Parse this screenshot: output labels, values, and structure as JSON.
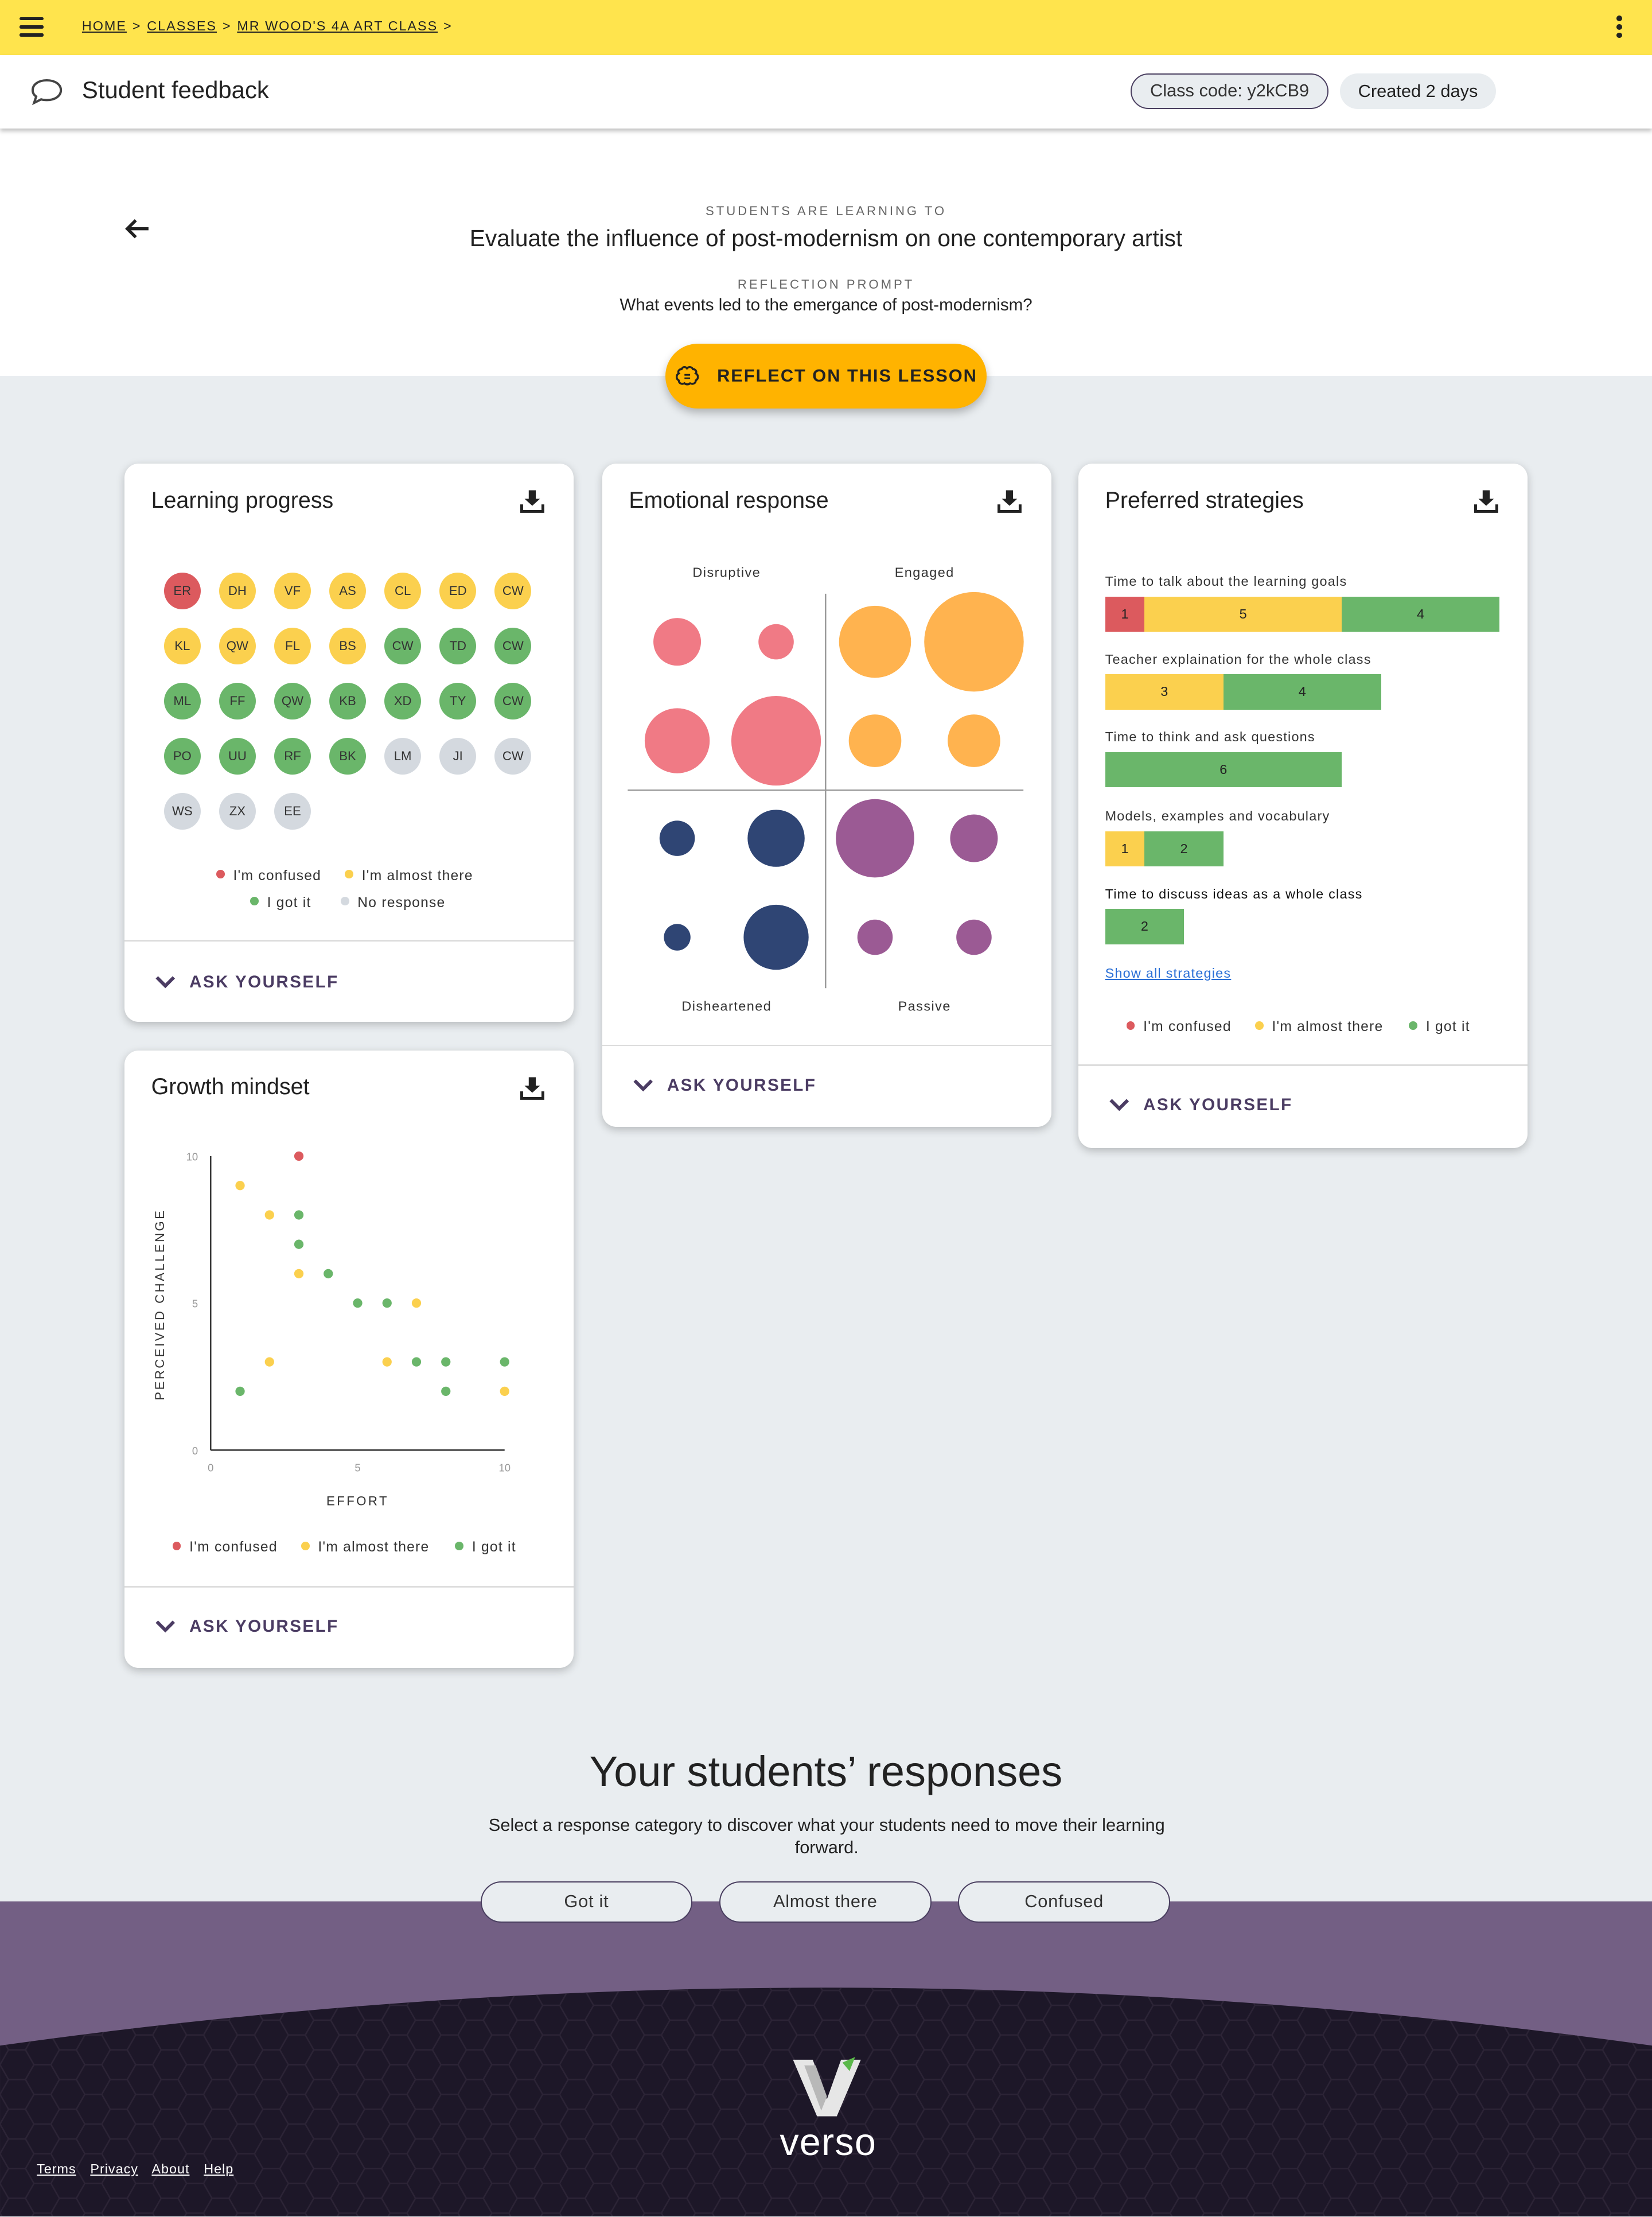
{
  "topbar": {
    "breadcrumbs": [
      {
        "label": "HOME"
      },
      {
        "label": "CLASSES"
      },
      {
        "label": "MR WOOD'S 4A ART CLASS"
      }
    ],
    "menu_icon": "hamburger-menu-icon",
    "more_icon": "vertical-dots-icon"
  },
  "header": {
    "title": "Student feedback",
    "icon": "chat-bubble-icon",
    "class_code": "Class code: y2kCB9",
    "created": "Created 2 days"
  },
  "lesson": {
    "learning_label": "STUDENTS ARE LEARNING TO",
    "learning_objective": "Evaluate the influence of post-modernism on one contemporary artist",
    "prompt_label": "REFLECTION PROMPT",
    "prompt": "What events led to the emergance of post-modernism?",
    "reflect_button": "REFLECT ON THIS LESSON",
    "reflect_icon": "brain-icon"
  },
  "colors": {
    "confused": "#dc5a5e",
    "almost": "#fbd04e",
    "gotit": "#6ab66a",
    "none": "#d4d9df",
    "accent_yellow": "#ffe44d",
    "reflect_orange": "#ffb300",
    "purple": "#735f84"
  },
  "learning_progress": {
    "title": "Learning progress",
    "students": [
      {
        "initials": "ER",
        "status": "confused"
      },
      {
        "initials": "DH",
        "status": "almost"
      },
      {
        "initials": "VF",
        "status": "almost"
      },
      {
        "initials": "AS",
        "status": "almost"
      },
      {
        "initials": "CL",
        "status": "almost"
      },
      {
        "initials": "ED",
        "status": "almost"
      },
      {
        "initials": "CW",
        "status": "almost"
      },
      {
        "initials": "KL",
        "status": "almost"
      },
      {
        "initials": "QW",
        "status": "almost"
      },
      {
        "initials": "FL",
        "status": "almost"
      },
      {
        "initials": "BS",
        "status": "almost"
      },
      {
        "initials": "CW",
        "status": "gotit"
      },
      {
        "initials": "TD",
        "status": "gotit"
      },
      {
        "initials": "CW",
        "status": "gotit"
      },
      {
        "initials": "ML",
        "status": "gotit"
      },
      {
        "initials": "FF",
        "status": "gotit"
      },
      {
        "initials": "QW",
        "status": "gotit"
      },
      {
        "initials": "KB",
        "status": "gotit"
      },
      {
        "initials": "XD",
        "status": "gotit"
      },
      {
        "initials": "TY",
        "status": "gotit"
      },
      {
        "initials": "CW",
        "status": "gotit"
      },
      {
        "initials": "PO",
        "status": "gotit"
      },
      {
        "initials": "UU",
        "status": "gotit"
      },
      {
        "initials": "RF",
        "status": "gotit"
      },
      {
        "initials": "BK",
        "status": "gotit"
      },
      {
        "initials": "LM",
        "status": "none"
      },
      {
        "initials": "JI",
        "status": "none"
      },
      {
        "initials": "CW",
        "status": "none"
      },
      {
        "initials": "WS",
        "status": "none"
      },
      {
        "initials": "ZX",
        "status": "none"
      },
      {
        "initials": "EE",
        "status": "none"
      }
    ],
    "legend": {
      "confused": "I'm confused",
      "almost": "I'm almost there",
      "gotit": "I got it",
      "none": "No response"
    },
    "ask": "ASK YOURSELF"
  },
  "emotional_response": {
    "title": "Emotional response",
    "quadrants": {
      "top_left": "Disruptive",
      "top_right": "Engaged",
      "bottom_left": "Disheartened",
      "bottom_right": "Passive"
    },
    "ask": "ASK YOURSELF"
  },
  "preferred_strategies": {
    "title": "Preferred strategies",
    "strategies": [
      {
        "label": "Time to talk about the learning goals",
        "confused": 1,
        "almost": 5,
        "gotit": 4
      },
      {
        "label": "Teacher explaination for the whole class",
        "confused": 0,
        "almost": 3,
        "gotit": 4
      },
      {
        "label": "Time to think and ask questions",
        "confused": 0,
        "almost": 0,
        "gotit": 6
      },
      {
        "label": "Models, examples and vocabulary",
        "confused": 0,
        "almost": 1,
        "gotit": 2
      },
      {
        "label": "Time to discuss ideas as a whole class",
        "confused": 0,
        "almost": 0,
        "gotit": 2
      }
    ],
    "show_all": "Show all strategies",
    "legend": {
      "confused": "I'm confused",
      "almost": "I'm almost there",
      "gotit": "I got it"
    },
    "ask": "ASK YOURSELF"
  },
  "growth_mindset": {
    "title": "Growth mindset",
    "legend": {
      "confused": "I'm confused",
      "almost": "I'm almost there",
      "gotit": "I got it"
    },
    "ask": "ASK YOURSELF"
  },
  "chart_data": [
    {
      "type": "scatter",
      "title": "Emotional response",
      "x_labels": [
        "Disruptive",
        "Engaged"
      ],
      "bottom_labels": [
        "Disheartened",
        "Passive"
      ],
      "bubbles": [
        {
          "col": 0,
          "row": 0,
          "size": 2,
          "color": "#f07a85"
        },
        {
          "col": 1,
          "row": 0,
          "size": 1,
          "color": "#f07a85"
        },
        {
          "col": 2,
          "row": 0,
          "size": 5,
          "color": "#ffb34f"
        },
        {
          "col": 3,
          "row": 0,
          "size": 10,
          "color": "#ffb34f"
        },
        {
          "col": 0,
          "row": 1,
          "size": 4,
          "color": "#f07a85"
        },
        {
          "col": 1,
          "row": 1,
          "size": 8,
          "color": "#f07a85"
        },
        {
          "col": 2,
          "row": 1,
          "size": 2.5,
          "color": "#ffb34f"
        },
        {
          "col": 3,
          "row": 1,
          "size": 2.5,
          "color": "#ffb34f"
        },
        {
          "col": 0,
          "row": 2,
          "size": 1,
          "color": "#2f4574"
        },
        {
          "col": 1,
          "row": 2,
          "size": 3,
          "color": "#2f4574"
        },
        {
          "col": 2,
          "row": 2,
          "size": 6,
          "color": "#9b5a94"
        },
        {
          "col": 3,
          "row": 2,
          "size": 2,
          "color": "#9b5a94"
        },
        {
          "col": 0,
          "row": 3,
          "size": 0.5,
          "color": "#2f4574"
        },
        {
          "col": 1,
          "row": 3,
          "size": 4,
          "color": "#2f4574"
        },
        {
          "col": 2,
          "row": 3,
          "size": 1,
          "color": "#9b5a94"
        },
        {
          "col": 3,
          "row": 3,
          "size": 1,
          "color": "#9b5a94"
        }
      ]
    },
    {
      "type": "bar",
      "title": "Preferred strategies",
      "categories": [
        "Time to talk about the learning goals",
        "Teacher explaination for the whole class",
        "Time to think and ask questions",
        "Models, examples and vocabulary",
        "Time to discuss ideas as a whole class"
      ],
      "series": [
        {
          "name": "I'm confused",
          "values": [
            1,
            0,
            0,
            0,
            0
          ]
        },
        {
          "name": "I'm almost there",
          "values": [
            5,
            3,
            0,
            1,
            0
          ]
        },
        {
          "name": "I got it",
          "values": [
            4,
            4,
            6,
            2,
            2
          ]
        }
      ]
    },
    {
      "type": "scatter",
      "title": "Growth mindset",
      "xlabel": "EFFORT",
      "ylabel": "PERCEIVED CHALLENGE",
      "xlim": [
        0,
        10
      ],
      "ylim": [
        0,
        10
      ],
      "x_ticks": [
        "0",
        "5",
        "10"
      ],
      "y_ticks": [
        "0",
        "5",
        "10"
      ],
      "points": [
        {
          "x": 3,
          "y": 10,
          "status": "confused"
        },
        {
          "x": 1,
          "y": 9,
          "status": "almost"
        },
        {
          "x": 2,
          "y": 8,
          "status": "almost"
        },
        {
          "x": 3,
          "y": 8,
          "status": "gotit"
        },
        {
          "x": 3,
          "y": 7,
          "status": "gotit"
        },
        {
          "x": 3,
          "y": 6,
          "status": "almost"
        },
        {
          "x": 4,
          "y": 6,
          "status": "gotit"
        },
        {
          "x": 5,
          "y": 5,
          "status": "gotit"
        },
        {
          "x": 6,
          "y": 5,
          "status": "gotit"
        },
        {
          "x": 7,
          "y": 5,
          "status": "almost"
        },
        {
          "x": 2,
          "y": 3,
          "status": "almost"
        },
        {
          "x": 6,
          "y": 3,
          "status": "almost"
        },
        {
          "x": 7,
          "y": 3,
          "status": "gotit"
        },
        {
          "x": 8,
          "y": 3,
          "status": "gotit"
        },
        {
          "x": 10,
          "y": 3,
          "status": "gotit"
        },
        {
          "x": 1,
          "y": 2,
          "status": "gotit"
        },
        {
          "x": 8,
          "y": 2,
          "status": "gotit"
        },
        {
          "x": 10,
          "y": 2,
          "status": "almost"
        }
      ]
    }
  ],
  "responses": {
    "title": "Your students’ responses",
    "subtitle": "Select a response category to discover what your students need to move their learning forward.",
    "buttons": [
      "Got it",
      "Almost there",
      "Confused"
    ]
  },
  "footer": {
    "links": [
      "Terms",
      "Privacy",
      "About",
      "Help"
    ],
    "brand": "verso",
    "logo_icon": "verso-logo-icon"
  }
}
